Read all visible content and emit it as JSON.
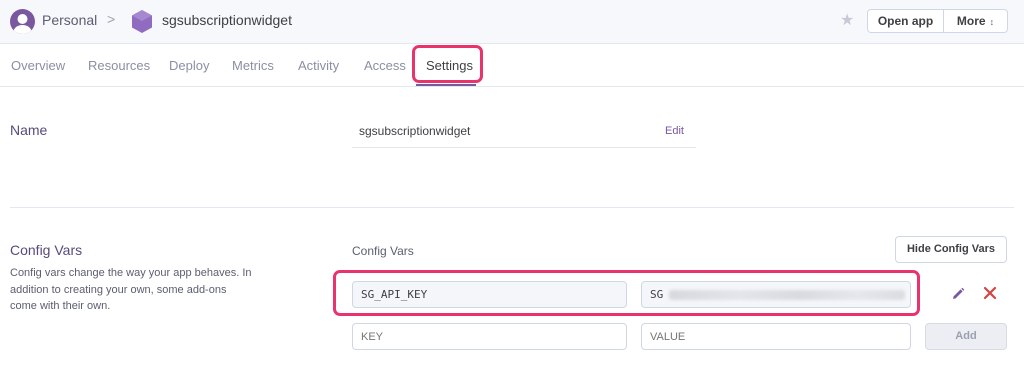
{
  "header": {
    "account": "Personal",
    "separator": ">",
    "app_name": "sgsubscriptionwidget",
    "open_app_label": "Open app",
    "more_label": "More",
    "more_icon": "↕"
  },
  "tabs": [
    {
      "label": "Overview",
      "active": false
    },
    {
      "label": "Resources",
      "active": false
    },
    {
      "label": "Deploy",
      "active": false
    },
    {
      "label": "Metrics",
      "active": false
    },
    {
      "label": "Activity",
      "active": false
    },
    {
      "label": "Access",
      "active": false
    },
    {
      "label": "Settings",
      "active": true
    }
  ],
  "name_section": {
    "label": "Name",
    "value": "sgsubscriptionwidget",
    "edit_label": "Edit"
  },
  "config_vars": {
    "title": "Config Vars",
    "description": "Config vars change the way your app behaves. In addition to creating your own, some add-ons come with their own.",
    "column_label": "Config Vars",
    "hide_button": "Hide Config Vars",
    "vars": [
      {
        "key": "SG_API_KEY",
        "value_prefix": "SG"
      }
    ],
    "new_key_placeholder": "KEY",
    "new_value_placeholder": "VALUE",
    "add_label": "Add"
  },
  "colors": {
    "brand": "#79589f",
    "highlight": "#e8336d",
    "delete": "#d64242"
  }
}
